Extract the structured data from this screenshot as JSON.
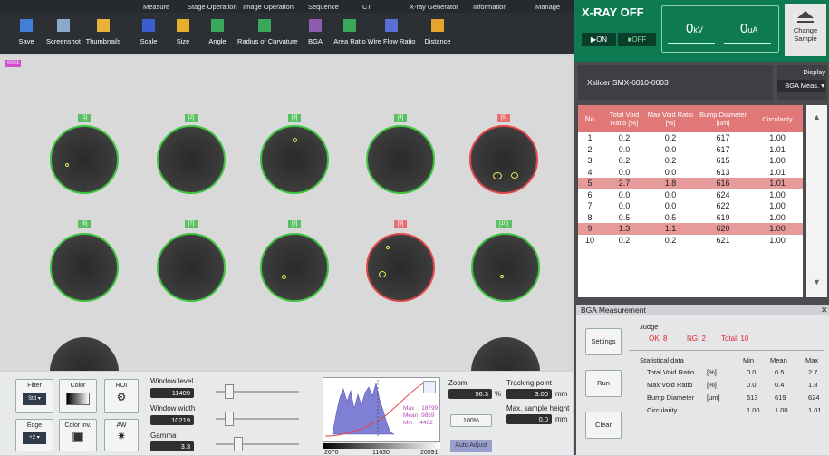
{
  "menu": [
    "Measure",
    "Stage Operation",
    "Image Operation",
    "Sequence",
    "CT",
    "X-ray Generator",
    "Information",
    "Manage"
  ],
  "toolbar": [
    "Save",
    "Screenshot",
    "Thumbnails",
    "Scale",
    "Size",
    "Angle",
    "Radius of Curvature",
    "BGA",
    "Area Ratio",
    "Wire Flow Ratio",
    "Distance"
  ],
  "xray": {
    "status": "X-RAY OFF",
    "on": "ON",
    "off": "OFF",
    "kv": "0",
    "kv_unit": "kV",
    "ua": "0",
    "ua_unit": "uA",
    "change_sample": "Change Sample"
  },
  "viewer": {
    "tag": "0001",
    "labels": [
      "[1]",
      "[2]",
      "[3]",
      "[4]",
      "[5]",
      "[6]",
      "[7]",
      "[8]",
      "[9]",
      "[10]"
    ]
  },
  "bottom": {
    "filter": "Filter",
    "filter_val": "Std",
    "color": "Color",
    "roi": "ROI",
    "edge": "Edge",
    "edge_val": "+2",
    "color_inv": "Color inv.",
    "aw": "AW",
    "window_level_label": "Window level",
    "window_level": "11409",
    "window_width_label": "Window width",
    "window_width": "10219",
    "gamma_label": "Gamma",
    "gamma": "3.3",
    "hist_min": "2670",
    "hist_mid": "11630",
    "hist_max": "20591",
    "hist_max_label": "Max",
    "hist_mean_label": "Mean",
    "hist_min_label": "Min",
    "hist_max_val": "18799",
    "hist_mean_val": "9859",
    "hist_min_val": "4462",
    "zoom_label": "Zoom",
    "zoom": "56.3",
    "zoom_unit": "%",
    "zoom_100": "100%",
    "tracking_label": "Tracking point",
    "tracking": "3.00",
    "tracking_unit": "mm",
    "max_height_label": "Max. sample height",
    "max_height": "0.0",
    "max_height_unit": "mm",
    "auto_adjust": "Auto Adjust"
  },
  "right": {
    "device": "Xslicer SMX-6010-0003",
    "display": "Display",
    "display_mode": "BGA Meas.",
    "headers": [
      "No",
      "Total Void Ratio [%]",
      "Max Void Ratio [%]",
      "Bump Diameter [um]",
      "Circularity"
    ],
    "rows": [
      [
        "1",
        "0.2",
        "0.2",
        "617",
        "1.00"
      ],
      [
        "2",
        "0.0",
        "0.0",
        "617",
        "1.01"
      ],
      [
        "3",
        "0.2",
        "0.2",
        "615",
        "1.00"
      ],
      [
        "4",
        "0.0",
        "0.0",
        "613",
        "1.01"
      ],
      [
        "5",
        "2.7",
        "1.8",
        "616",
        "1.01"
      ],
      [
        "6",
        "0.0",
        "0.0",
        "624",
        "1.00"
      ],
      [
        "7",
        "0.0",
        "0.0",
        "622",
        "1.00"
      ],
      [
        "8",
        "0.5",
        "0.5",
        "619",
        "1.00"
      ],
      [
        "9",
        "1.3",
        "1.1",
        "620",
        "1.00"
      ],
      [
        "10",
        "0.2",
        "0.2",
        "621",
        "1.00"
      ]
    ],
    "ng_rows": [
      4,
      8
    ]
  },
  "meas": {
    "title": "BGA Measurement",
    "judge": "Judge",
    "ok": "OK: 8",
    "ng": "NG: 2",
    "total": "Total: 10",
    "settings": "Settings",
    "run": "Run",
    "clear": "Clear",
    "stat_title": "Statistical data",
    "col_min": "Min",
    "col_mean": "Mean",
    "col_max": "Max",
    "stats": [
      [
        "Total Void Ratio",
        "[%]",
        "0.0",
        "0.5",
        "2.7"
      ],
      [
        "Max Void Ratio",
        "[%]",
        "0.0",
        "0.4",
        "1.8"
      ],
      [
        "Bump Diameter",
        "[um]",
        "613",
        "619",
        "624"
      ],
      [
        "Circularity",
        "",
        "1.00",
        "1.00",
        "1.01"
      ]
    ]
  },
  "colors": {
    "accent": "#0d7a52",
    "ok": "#3cc43c",
    "ng": "#e04848",
    "ng_row": "#e79a9a"
  }
}
